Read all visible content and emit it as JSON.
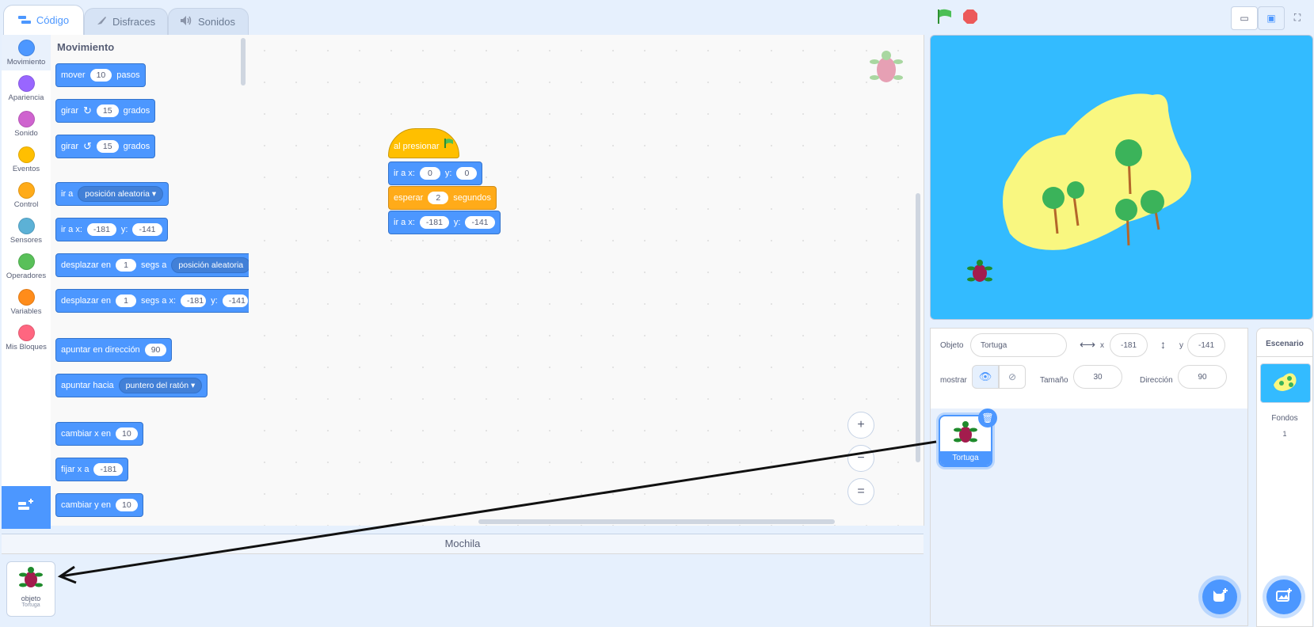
{
  "tabs": [
    {
      "label": "Código",
      "icon": "code-icon"
    },
    {
      "label": "Disfraces",
      "icon": "brush-icon"
    },
    {
      "label": "Sonidos",
      "icon": "speaker-icon"
    }
  ],
  "categories": [
    {
      "label": "Movimiento",
      "color": "#4c97ff"
    },
    {
      "label": "Apariencia",
      "color": "#9966ff"
    },
    {
      "label": "Sonido",
      "color": "#cf63cf"
    },
    {
      "label": "Eventos",
      "color": "#ffbf00"
    },
    {
      "label": "Control",
      "color": "#ffab19"
    },
    {
      "label": "Sensores",
      "color": "#5cb1d6"
    },
    {
      "label": "Operadores",
      "color": "#59c059"
    },
    {
      "label": "Variables",
      "color": "#ff8c1a"
    },
    {
      "label": "Mis Bloques",
      "color": "#ff6680"
    }
  ],
  "palette": {
    "title": "Movimiento",
    "move": {
      "a": "mover",
      "v": "10",
      "b": "pasos"
    },
    "turn_right": {
      "a": "girar",
      "v": "15",
      "b": "grados"
    },
    "turn_left": {
      "a": "girar",
      "v": "15",
      "b": "grados"
    },
    "goto": {
      "a": "ir a",
      "d": "posición aleatoria"
    },
    "goto_xy": {
      "a": "ir a x:",
      "x": "-181",
      "b": "y:",
      "y": "-141"
    },
    "glide": {
      "a": "desplazar en",
      "v": "1",
      "b": "segs a",
      "d": "posición aleatoria"
    },
    "glide_xy": {
      "a": "desplazar en",
      "v": "1",
      "b": "segs a x:",
      "x": "-181",
      "c": "y:",
      "y": "-141"
    },
    "point_dir": {
      "a": "apuntar en dirección",
      "v": "90"
    },
    "point_towards": {
      "a": "apuntar hacia",
      "d": "puntero del ratón"
    },
    "change_x": {
      "a": "cambiar x en",
      "v": "10"
    },
    "set_x": {
      "a": "fijar x a",
      "v": "-181"
    },
    "change_y": {
      "a": "cambiar y en",
      "v": "10"
    }
  },
  "script": {
    "hat": "al presionar",
    "goto1": {
      "a": "ir a x:",
      "x": "0",
      "b": "y:",
      "y": "0"
    },
    "wait": {
      "a": "esperar",
      "v": "2",
      "b": "segundos"
    },
    "goto2": {
      "a": "ir a x:",
      "x": "-181",
      "b": "y:",
      "y": "-141"
    }
  },
  "zoom": {
    "in": "+",
    "out": "−",
    "reset": "="
  },
  "backpack": {
    "title": "Mochila",
    "item_label": "objeto",
    "item_sub": "Tortuga"
  },
  "sprite_info": {
    "objeto_label": "Objeto",
    "name": "Tortuga",
    "x_label": "x",
    "x": "-181",
    "y_label": "y",
    "y": "-141",
    "show_label": "mostrar",
    "size_label": "Tamaño",
    "size": "30",
    "direction_label": "Dirección",
    "direction": "90"
  },
  "sprite_list": [
    {
      "name": "Tortuga"
    }
  ],
  "stage_panel": {
    "title": "Escenario",
    "backdrops_label": "Fondos",
    "backdrops_count": "1"
  },
  "colors": {
    "accent": "#4c97ff",
    "stage_bg": "#33bbff",
    "island": "#f9f780",
    "events": "#ffbf00",
    "control": "#ffab19"
  }
}
